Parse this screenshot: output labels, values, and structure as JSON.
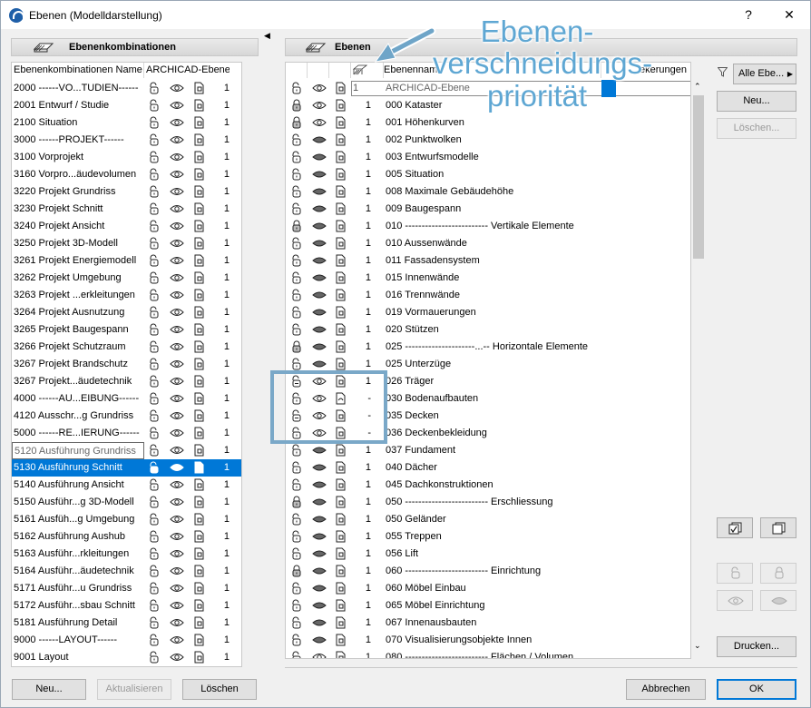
{
  "window": {
    "title": "Ebenen (Modelldarstellung)",
    "help_label": "?",
    "close_label": "✕"
  },
  "left": {
    "header": "Ebenenkombinationen",
    "col_name": "Ebenenkombinationen Name",
    "col_archicad": "ARCHICAD-Ebene",
    "rows": [
      {
        "name": "2000 ------VO...TUDIEN------",
        "value": "1"
      },
      {
        "name": "2001 Entwurf / Studie",
        "value": "1"
      },
      {
        "name": "2100 Situation",
        "value": "1"
      },
      {
        "name": "3000 ------PROJEKT------",
        "value": "1"
      },
      {
        "name": "3100 Vorprojekt",
        "value": "1"
      },
      {
        "name": "3160 Vorpro...äudevolumen",
        "value": "1"
      },
      {
        "name": "3220 Projekt Grundriss",
        "value": "1"
      },
      {
        "name": "3230 Projekt Schnitt",
        "value": "1"
      },
      {
        "name": "3240 Projekt Ansicht",
        "value": "1"
      },
      {
        "name": "3250 Projekt 3D-Modell",
        "value": "1"
      },
      {
        "name": "3261 Projekt Energiemodell",
        "value": "1"
      },
      {
        "name": "3262 Projekt Umgebung",
        "value": "1"
      },
      {
        "name": "3263 Projekt ...erkleitungen",
        "value": "1"
      },
      {
        "name": "3264 Projekt Ausnutzung",
        "value": "1"
      },
      {
        "name": "3265 Projekt Baugespann",
        "value": "1"
      },
      {
        "name": "3266 Projekt Schutzraum",
        "value": "1"
      },
      {
        "name": "3267 Projekt Brandschutz",
        "value": "1"
      },
      {
        "name": "3267 Projekt...äudetechnik",
        "value": "1"
      },
      {
        "name": "4000 ------AU...EIBUNG------",
        "value": "1"
      },
      {
        "name": "4120 Ausschr...g Grundriss",
        "value": "1"
      },
      {
        "name": "5000 ------RE...IERUNG------",
        "value": "1"
      },
      {
        "name": "5120 Ausführung Grundriss",
        "value": "1"
      },
      {
        "name": "5130 Ausführung Schnitt",
        "value": "1"
      },
      {
        "name": "5140 Ausführung Ansicht",
        "value": "1"
      },
      {
        "name": "5150 Ausführ...g 3D-Modell",
        "value": "1"
      },
      {
        "name": "5161 Ausfüh...g Umgebung",
        "value": "1"
      },
      {
        "name": "5162 Ausführung Aushub",
        "value": "1"
      },
      {
        "name": "5163 Ausführ...rkleitungen",
        "value": "1"
      },
      {
        "name": "5164 Ausführ...äudetechnik",
        "value": "1"
      },
      {
        "name": "5171 Ausführ...u Grundriss",
        "value": "1"
      },
      {
        "name": "5172 Ausführ...sbau Schnitt",
        "value": "1"
      },
      {
        "name": "5181 Ausführung Detail",
        "value": "1"
      },
      {
        "name": "9000 ------LAYOUT------",
        "value": "1"
      },
      {
        "name": "9001 Layout",
        "value": "1"
      }
    ],
    "buttons": {
      "new": "Neu...",
      "update": "Aktualisieren",
      "delete": "Löschen"
    }
  },
  "right": {
    "header": "Ebenen",
    "col_name": "Ebenennam",
    "col_extra": "ekerungen",
    "rows": [
      {
        "prio": "1",
        "name": "ARCHICAD-Ebene"
      },
      {
        "prio": "1",
        "name": "000 Kataster"
      },
      {
        "prio": "1",
        "name": "001 Höhenkurven"
      },
      {
        "prio": "1",
        "name": "002 Punktwolken"
      },
      {
        "prio": "1",
        "name": "003 Entwurfsmodelle"
      },
      {
        "prio": "1",
        "name": "005 Situation"
      },
      {
        "prio": "1",
        "name": "008 Maximale Gebäudehöhe"
      },
      {
        "prio": "1",
        "name": "009 Baugespann"
      },
      {
        "prio": "1",
        "name": "010 ------------------------- Vertikale Elemente"
      },
      {
        "prio": "1",
        "name": "010 Aussenwände"
      },
      {
        "prio": "1",
        "name": "011 Fassadensystem"
      },
      {
        "prio": "1",
        "name": "015 Innenwände"
      },
      {
        "prio": "1",
        "name": "016 Trennwände"
      },
      {
        "prio": "1",
        "name": "019 Vormauerungen"
      },
      {
        "prio": "1",
        "name": "020 Stützen"
      },
      {
        "prio": "1",
        "name": "025 ---------------------...-- Horizontale Elemente"
      },
      {
        "prio": "1",
        "name": "025 Unterzüge"
      },
      {
        "prio": "1",
        "name": "026 Träger"
      },
      {
        "prio": "-",
        "name": "030 Bodenaufbauten"
      },
      {
        "prio": "-",
        "name": "035 Decken"
      },
      {
        "prio": "-",
        "name": "036 Deckenbekleidung"
      },
      {
        "prio": "1",
        "name": "037 Fundament"
      },
      {
        "prio": "1",
        "name": "040 Dächer"
      },
      {
        "prio": "1",
        "name": "045 Dachkonstruktionen"
      },
      {
        "prio": "1",
        "name": "050 ------------------------- Erschliessung"
      },
      {
        "prio": "1",
        "name": "050 Geländer"
      },
      {
        "prio": "1",
        "name": "055 Treppen"
      },
      {
        "prio": "1",
        "name": "056 Lift"
      },
      {
        "prio": "1",
        "name": "060 ------------------------- Einrichtung"
      },
      {
        "prio": "1",
        "name": "060 Möbel Einbau"
      },
      {
        "prio": "1",
        "name": "065 Möbel Einrichtung"
      },
      {
        "prio": "1",
        "name": "067 Innenausbauten"
      },
      {
        "prio": "1",
        "name": "070 Visualisierungsobjekte Innen"
      },
      {
        "prio": "1",
        "name": "080 ------------------------- Flächen / Volumen"
      }
    ],
    "filter_label": "Alle Ebe...",
    "buttons": {
      "new": "Neu...",
      "delete": "Löschen...",
      "print": "Drucken...",
      "cancel": "Abbrechen",
      "ok": "OK"
    }
  },
  "annotation": {
    "line1": "Ebenen-",
    "line2": "verschneidungs-",
    "line3": "priorität"
  },
  "colors": {
    "selection": "#0078d7",
    "annotation": "#5fa7d3",
    "highlight_box": "#7aa8c8"
  }
}
